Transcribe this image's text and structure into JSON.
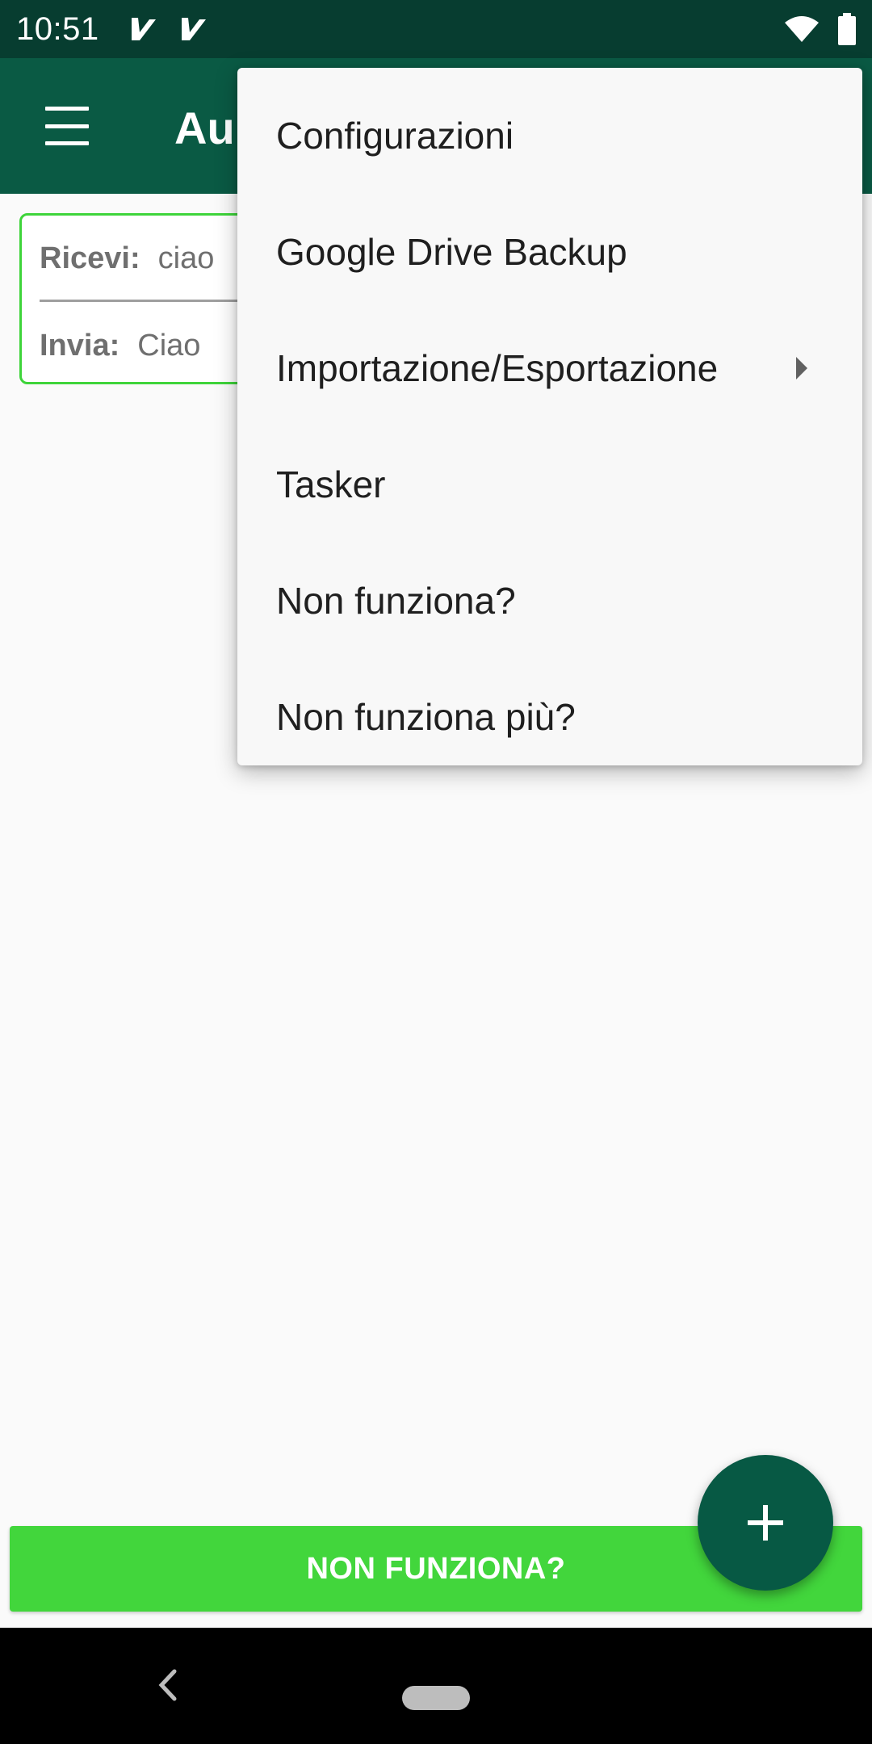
{
  "status_bar": {
    "time": "10:51",
    "icons_left": [
      "notification-check-icon",
      "notification-check-icon"
    ],
    "icons_right": [
      "wifi-icon",
      "battery-icon"
    ]
  },
  "app_bar": {
    "menu_icon": "hamburger-menu-icon",
    "title_visible": "Au"
  },
  "card": {
    "receive_label": "Ricevi:",
    "receive_value": "ciao",
    "send_label": "Invia:",
    "send_value": "Ciao"
  },
  "overflow_menu": {
    "items": [
      {
        "label": "Configurazioni"
      },
      {
        "label": "Google Drive Backup"
      },
      {
        "label": "Importazione/Esportazione",
        "has_submenu": true
      },
      {
        "label": "Tasker"
      },
      {
        "label": "Non funziona?"
      },
      {
        "label": "Non funziona più?"
      }
    ]
  },
  "bottom_button": {
    "label": "NON FUNZIONA?"
  },
  "fab": {
    "icon": "plus-icon"
  },
  "nav_bar": {
    "icons": [
      "back-icon",
      "home-pill-icon"
    ]
  },
  "colors": {
    "status_bar": "#073d30",
    "app_bar": "#0a5a44",
    "accent_green": "#42d63c",
    "fab": "#075944"
  }
}
